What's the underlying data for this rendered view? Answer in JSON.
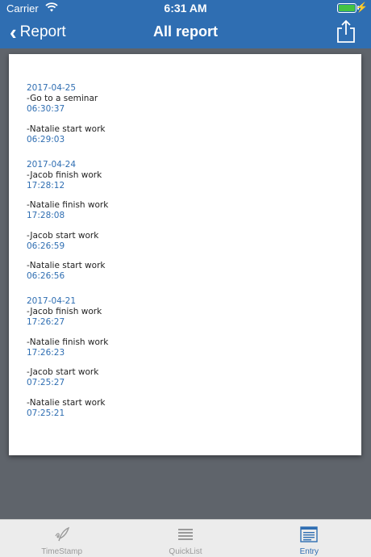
{
  "status_bar": {
    "carrier": "Carrier",
    "time": "6:31 AM"
  },
  "nav": {
    "back_label": "Report",
    "title": "All report"
  },
  "report": {
    "groups": [
      {
        "date": "2017-04-25",
        "entries": [
          {
            "text": "-Go to a seminar",
            "time": "06:30:37"
          },
          {
            "text": "-Natalie start work",
            "time": "06:29:03"
          }
        ]
      },
      {
        "date": "2017-04-24",
        "entries": [
          {
            "text": "-Jacob finish work",
            "time": "17:28:12"
          },
          {
            "text": "-Natalie finish work",
            "time": "17:28:08"
          },
          {
            "text": "-Jacob start work",
            "time": "06:26:59"
          },
          {
            "text": "-Natalie start work",
            "time": "06:26:56"
          }
        ]
      },
      {
        "date": "2017-04-21",
        "entries": [
          {
            "text": "-Jacob finish work",
            "time": "17:26:27"
          },
          {
            "text": "-Natalie finish work",
            "time": "17:26:23"
          },
          {
            "text": "-Jacob start work",
            "time": "07:25:27"
          },
          {
            "text": "-Natalie start work",
            "time": "07:25:21"
          }
        ]
      }
    ]
  },
  "tabs": [
    {
      "label": "TimeStamp",
      "icon": "quill-icon",
      "active": false
    },
    {
      "label": "QuickList",
      "icon": "list-icon",
      "active": false
    },
    {
      "label": "Entry",
      "icon": "document-icon",
      "active": true
    }
  ],
  "colors": {
    "accent": "#2f6eb2",
    "background": "#5f646b",
    "page": "#ffffff",
    "tab_inactive": "#9a9a9a"
  }
}
